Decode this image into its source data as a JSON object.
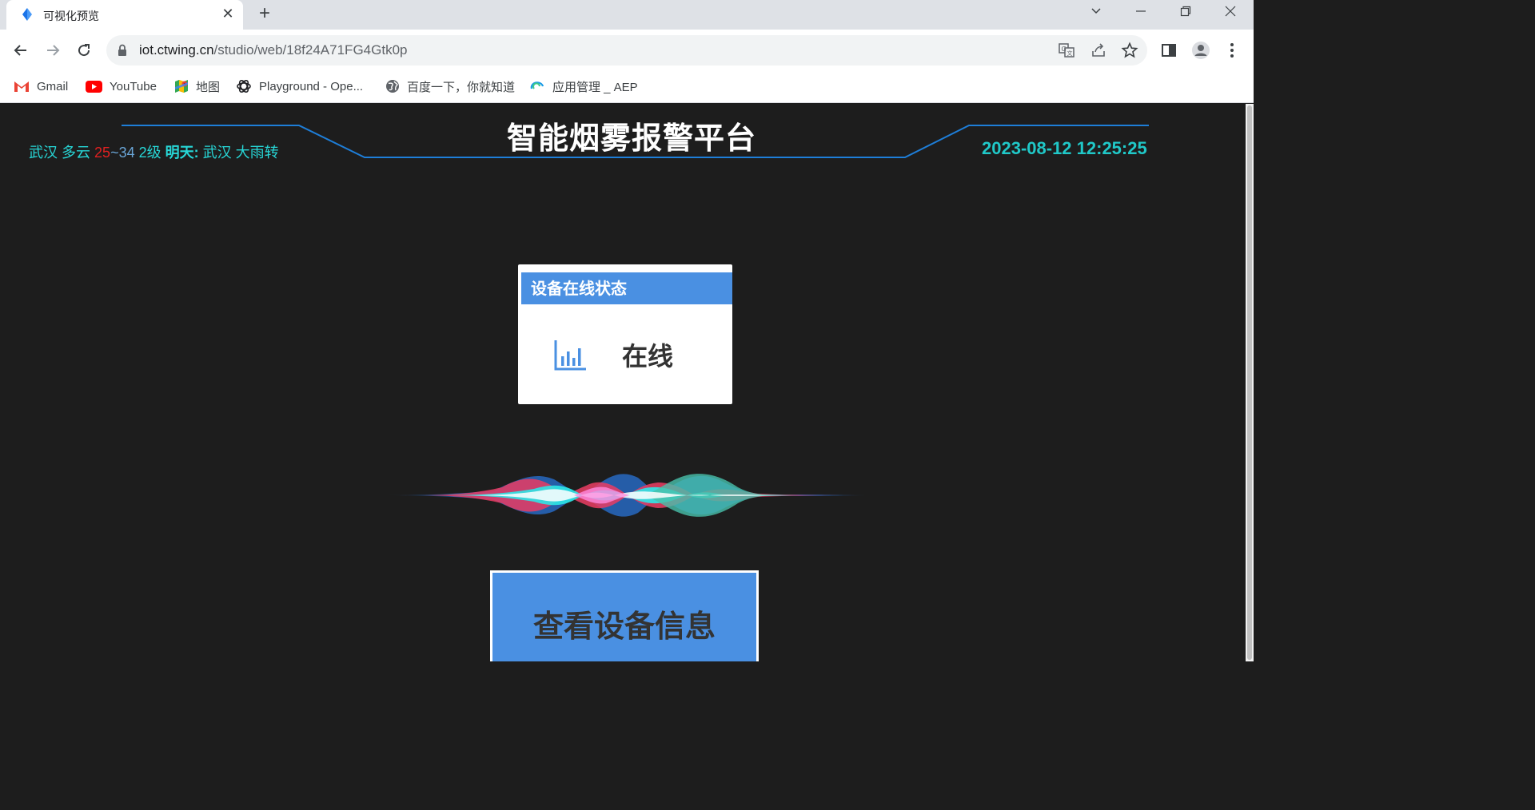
{
  "browser": {
    "tab": {
      "title": "可视化预览",
      "close_glyph": "✕"
    },
    "new_tab_glyph": "+",
    "url": {
      "host": "iot.ctwing.cn",
      "path": "/studio/web/18f24A71FG4Gtk0p"
    },
    "bookmarks": [
      {
        "label": "Gmail",
        "icon": "gmail-icon"
      },
      {
        "label": "YouTube",
        "icon": "youtube-icon"
      },
      {
        "label": "地图",
        "icon": "maps-icon"
      },
      {
        "label": "Playground - Ope...",
        "icon": "openai-icon"
      },
      {
        "label": "百度一下，你就知道",
        "icon": "globe-icon"
      },
      {
        "label": "应用管理 _ AEP",
        "icon": "aep-icon"
      }
    ]
  },
  "dashboard": {
    "title": "智能烟雾报警平台",
    "weather": {
      "city": "武汉",
      "condition": "多云",
      "temp_low": "25",
      "separator": "~",
      "temp_high": "34",
      "wind": "2级",
      "tomorrow_label": "明天:",
      "tomorrow_text": "武汉 大雨转"
    },
    "datetime": "2023-08-12 12:25:25",
    "status_card": {
      "title": "设备在线状态",
      "value": "在线"
    },
    "info_button": {
      "label": "查看设备信息"
    }
  },
  "colors": {
    "accent_blue": "#4a90e2",
    "cyan_text": "#27d7d7",
    "hot_temp": "#e02020",
    "cold_temp": "#6aa6d8",
    "header_line": "#1e7ed8",
    "page_bg": "#1d1d1d"
  }
}
